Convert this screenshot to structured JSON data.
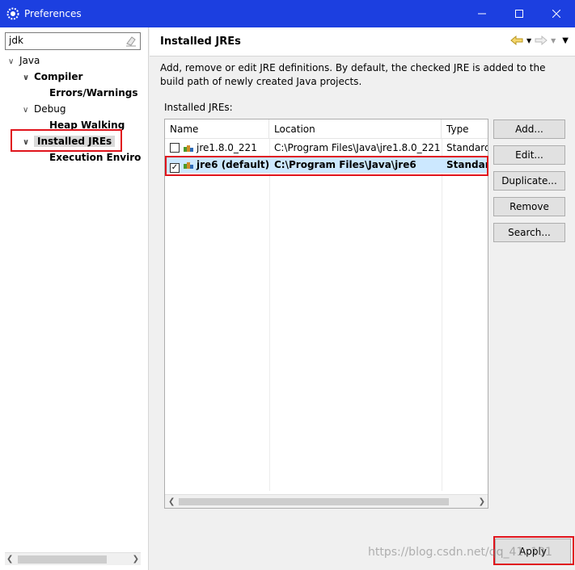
{
  "window": {
    "title": "Preferences",
    "controls": [
      "minimize",
      "maximize",
      "close"
    ]
  },
  "filter": {
    "value": "jdk"
  },
  "tree": [
    {
      "label": "Java",
      "expanded": true,
      "bold": false
    },
    {
      "label": "Compiler",
      "expanded": true,
      "bold": true
    },
    {
      "label": "Errors/Warnings",
      "bold": true
    },
    {
      "label": "Debug",
      "expanded": true,
      "bold": false
    },
    {
      "label": "Heap Walking",
      "bold": true
    },
    {
      "label": "Installed JREs",
      "expanded": true,
      "bold": true,
      "selected": true
    },
    {
      "label": "Execution Environ",
      "bold": true
    }
  ],
  "page": {
    "title": "Installed JREs",
    "description": "Add, remove or edit JRE definitions. By default, the checked JRE is added to the build path of newly created Java projects.",
    "table_label": "Installed JREs:"
  },
  "table": {
    "columns": [
      "Name",
      "Location",
      "Type"
    ],
    "rows": [
      {
        "name": "jre1.8.0_221",
        "location": "C:\\Program Files\\Java\\jre1.8.0_221",
        "type": "Standard",
        "checked": false,
        "selected": false
      },
      {
        "name": "jre6 (default)",
        "location": "C:\\Program Files\\Java\\jre6",
        "type": "Standard",
        "checked": true,
        "selected": true
      }
    ]
  },
  "buttons": {
    "add": "Add...",
    "edit": "Edit...",
    "duplicate": "Duplicate...",
    "remove": "Remove",
    "search": "Search...",
    "apply": "Apply"
  },
  "watermark": "https://blog.csdn.net/qq_41..101",
  "colors": {
    "titlebar": "#1c3fe0",
    "selection": "#cce8ff",
    "highlight_box": "#e0141c"
  }
}
